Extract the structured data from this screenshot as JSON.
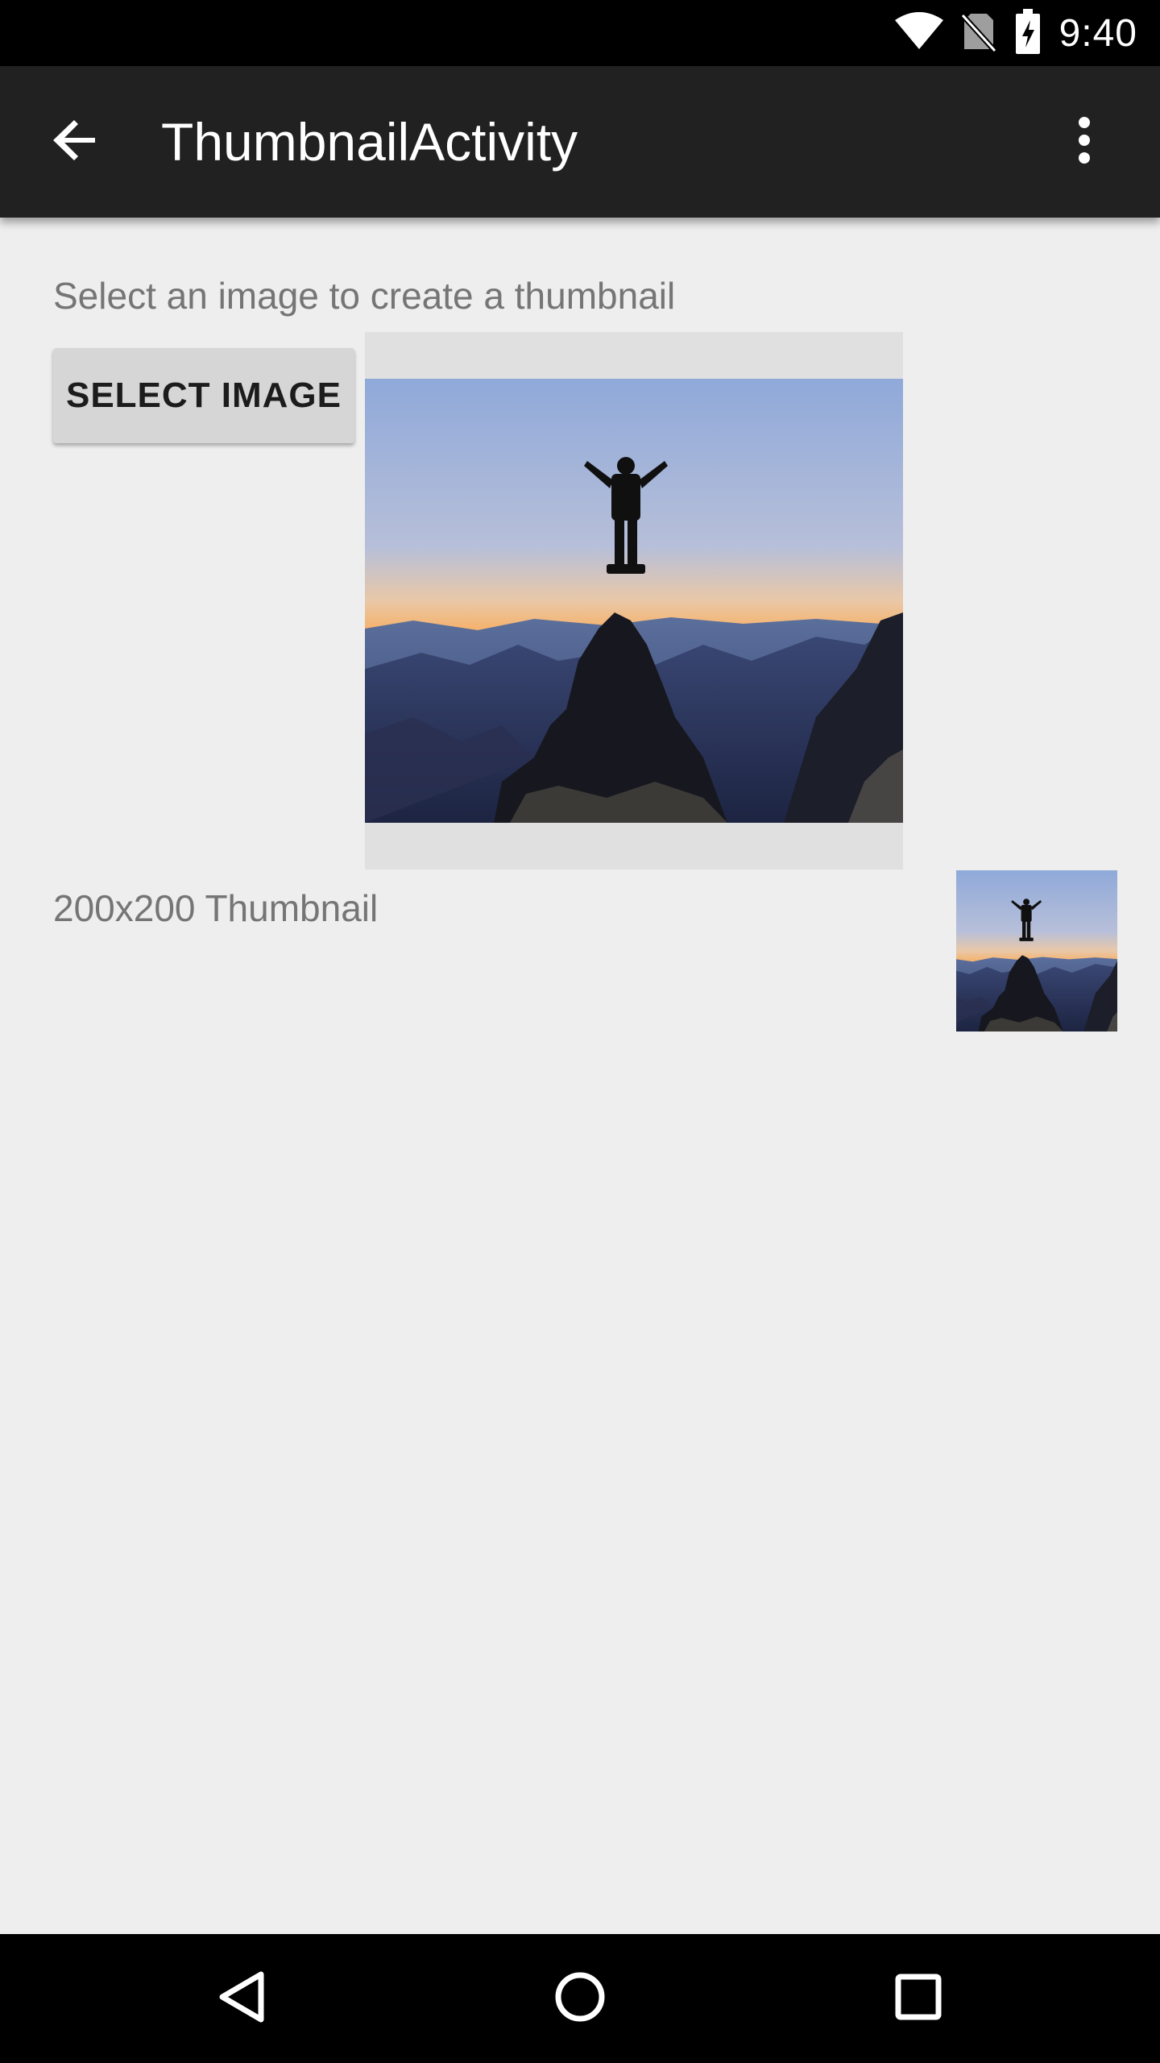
{
  "status_bar": {
    "time": "9:40",
    "icons": [
      "wifi-icon",
      "no-sim-icon",
      "battery-charging-icon"
    ]
  },
  "app_bar": {
    "title": "ThumbnailActivity",
    "back_icon": "arrow-back-icon",
    "menu_icon": "more-vert-icon"
  },
  "main": {
    "instruction": "Select an image to create a thumbnail",
    "select_button_label": "SELECT IMAGE",
    "preview_image": "mountain-summit-silhouette-photo",
    "thumbnail_label": "200x200 Thumbnail",
    "thumbnail_image": "mountain-summit-silhouette-thumbnail"
  },
  "nav_bar": {
    "icons": [
      "back-triangle-icon",
      "home-circle-icon",
      "recents-square-icon"
    ]
  },
  "colors": {
    "status_bar": "#000000",
    "app_bar": "#212121",
    "background": "#eeeeee",
    "button": "#d6d6d6",
    "secondary_text": "#757575"
  }
}
